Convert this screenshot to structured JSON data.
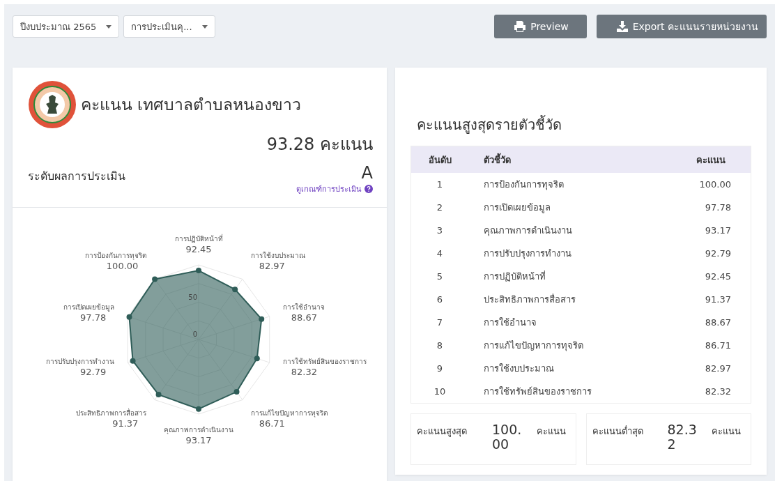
{
  "filters": [
    {
      "value": "ปีงบประมาณ 2565"
    },
    {
      "value": "การประเมินคุ..."
    }
  ],
  "buttons": [
    {
      "kind": "print",
      "label": "Preview"
    },
    {
      "kind": "download",
      "label": "Export คะแนนรายหน่วยงาน"
    }
  ],
  "score_card": {
    "title": "คะแนน เทศบาลตำบลหนองขาว",
    "score": "93.28 คะแนน",
    "level_label": "ระดับผลการประเมิน",
    "grade": "A",
    "criteria_link": "ดูเกณฑ์การประเมิน",
    "radar": {
      "scale_labels": [
        "50",
        "0"
      ],
      "top_axis": {
        "label": "การปฏิบัติหน้าที่",
        "value": "92.45"
      },
      "left_axes": [
        {
          "label": "การป้องกันการทุจริต",
          "value": "100.00"
        },
        {
          "label": "การเปิดเผยข้อมูล",
          "value": "97.78"
        },
        {
          "label": "การปรับปรุงการทำงาน",
          "value": "92.79"
        },
        {
          "label": "ประสิทธิภาพการสื่อสาร",
          "value": "91.37"
        }
      ],
      "right_axes": [
        {
          "label": "การใช้งบประมาณ",
          "value": "82.97"
        },
        {
          "label": "การใช้อำนาจ",
          "value": "88.67"
        },
        {
          "label": "การใช้ทรัพย์สินของราชการ",
          "value": "82.32"
        },
        {
          "label": "การแก้ไขปัญหาการทุจริต",
          "value": "86.71"
        }
      ],
      "bottom_axis": {
        "label": "คุณภาพการดำเนินงาน",
        "value": "93.17"
      }
    }
  },
  "ranking": {
    "title": "คะแนนสูงสุดรายตัวชี้วัด",
    "columns": [
      "อันดับ",
      "ตัวชี้วัด",
      "คะแนน"
    ],
    "rows": [
      {
        "rank": "1",
        "indicator": "การป้องกันการทุจริต",
        "score": "100.00"
      },
      {
        "rank": "2",
        "indicator": "การเปิดเผยข้อมูล",
        "score": "97.78"
      },
      {
        "rank": "3",
        "indicator": "คุณภาพการดำเนินงาน",
        "score": "93.17"
      },
      {
        "rank": "4",
        "indicator": "การปรับปรุงการทำงาน",
        "score": "92.79"
      },
      {
        "rank": "5",
        "indicator": "การปฏิบัติหน้าที่",
        "score": "92.45"
      },
      {
        "rank": "6",
        "indicator": "ประสิทธิภาพการสื่อสาร",
        "score": "91.37"
      },
      {
        "rank": "7",
        "indicator": "การใช้อำนาจ",
        "score": "88.67"
      },
      {
        "rank": "8",
        "indicator": "การแก้ไขปัญหาการทุจริต",
        "score": "86.71"
      },
      {
        "rank": "9",
        "indicator": "การใช้งบประมาณ",
        "score": "82.97"
      },
      {
        "rank": "10",
        "indicator": "การใช้ทรัพย์สินของราชการ",
        "score": "82.32"
      }
    ],
    "stats": [
      {
        "label": "คะแนนสูงสุด",
        "value": "100.00",
        "unit": "คะแนน"
      },
      {
        "label": "คะแนนต่ำสุด",
        "value": "82.32",
        "unit": "คะแนน"
      }
    ]
  }
}
